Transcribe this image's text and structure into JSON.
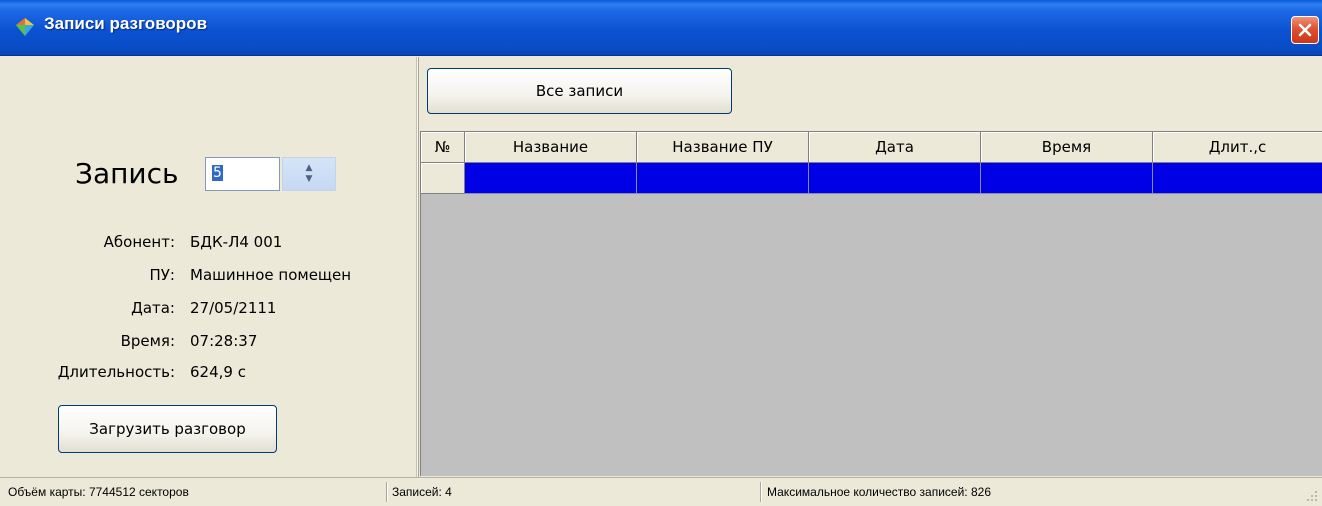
{
  "window": {
    "title": "Записи разговоров",
    "icon": "app-diamond-icon",
    "close_icon": "close-icon"
  },
  "record": {
    "label": "Запись",
    "value": "5"
  },
  "info": [
    {
      "label": "Абонент:",
      "value": "БДК-Л4 001"
    },
    {
      "label": "ПУ:",
      "value": "Машинное помещен"
    },
    {
      "label": "Дата:",
      "value": "27/05/2111"
    },
    {
      "label": "Время:",
      "value": "07:28:37"
    },
    {
      "label": "Длительность:",
      "value": "624,9 с"
    }
  ],
  "buttons": {
    "load": "Загрузить разговор",
    "all_records": "Все записи"
  },
  "table": {
    "columns": [
      "№",
      "Название",
      "Название ПУ",
      "Дата",
      "Время",
      "Длит.,с"
    ],
    "rows": [
      [
        "",
        "",
        "",
        "",
        "",
        ""
      ]
    ],
    "selected_row_color": "#0000e6"
  },
  "status": {
    "card_volume": "Объём карты: 7744512 секторов",
    "records": "Записей: 4",
    "max_records": "Максимальное количество записей: 826"
  }
}
